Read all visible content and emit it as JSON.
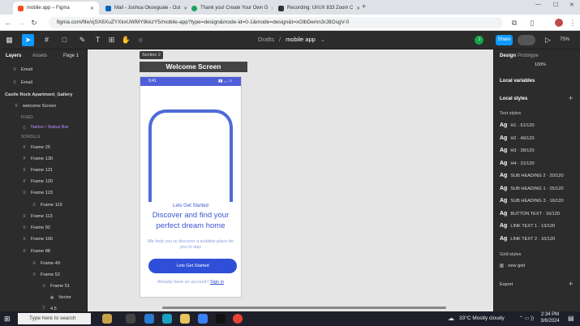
{
  "browser": {
    "tabs": [
      {
        "title": "mobile app – Figma",
        "active": true,
        "color": "#f24e1e"
      },
      {
        "title": "Mail - Joshua Okoeguale - Out",
        "active": false,
        "color": "#0a66c2"
      },
      {
        "title": "Thank you! Create Your Own G",
        "active": false,
        "color": "#1aa260"
      },
      {
        "title": "Recording: UI/UX 833 Zoom C",
        "active": false,
        "color": "#333333"
      }
    ],
    "url": "figma.com/file/xjSX6XuZYXkxUWMY9kkzY5/mobile-app?type=design&mode-id=0-1&mode=design&t=xOlbDemn3rJ8OsgV-0"
  },
  "figma": {
    "breadcrumb_drafts": "Drafts",
    "breadcrumb_sep": "/",
    "file_name": "mobile app",
    "share_label": "Share",
    "zoom": "75%",
    "avatar_initial": "J"
  },
  "layers_panel": {
    "tab_layers": "Layers",
    "tab_assets": "Assets",
    "page_label": "Page 1",
    "rows": [
      {
        "label": "Email",
        "indent": 28,
        "icon": "≡"
      },
      {
        "label": "Email",
        "indent": 28,
        "icon": "≡"
      },
      {
        "label": "Castle Rock Apartment_Gallery",
        "indent": 8,
        "icon": "",
        "bold": true
      },
      {
        "label": "welcome Screen",
        "indent": 18,
        "icon": "#"
      },
      {
        "label": "FIXED",
        "indent": 28,
        "icon": "",
        "section": true
      },
      {
        "label": "Native / Status Bar",
        "indent": 28,
        "icon": "◇",
        "purple": true
      },
      {
        "label": "SCROLLS",
        "indent": 28,
        "icon": "",
        "section": true
      },
      {
        "label": "Frame 25",
        "indent": 28,
        "icon": "#"
      },
      {
        "label": "Frame 130",
        "indent": 28,
        "icon": "#"
      },
      {
        "label": "Frame 121",
        "indent": 28,
        "icon": "#"
      },
      {
        "label": "Frame 120",
        "indent": 28,
        "icon": "#"
      },
      {
        "label": "Frame 123",
        "indent": 28,
        "icon": "≡"
      },
      {
        "label": "Frame 119",
        "indent": 40,
        "icon": "≡"
      },
      {
        "label": "Frame 113",
        "indent": 28,
        "icon": "≡"
      },
      {
        "label": "Frame 92",
        "indent": 28,
        "icon": "≡"
      },
      {
        "label": "Frame 100",
        "indent": 28,
        "icon": "≡"
      },
      {
        "label": "Frame 88",
        "indent": 28,
        "icon": "≡"
      },
      {
        "label": "Frame 49",
        "indent": 40,
        "icon": "≡"
      },
      {
        "label": "Frame 52",
        "indent": 40,
        "icon": "≡"
      },
      {
        "label": "Frame 51",
        "indent": 52,
        "icon": "≡"
      },
      {
        "label": "Vector",
        "indent": 62,
        "icon": "✱"
      },
      {
        "label": "4.5",
        "indent": 52,
        "icon": "T"
      }
    ]
  },
  "right_panel": {
    "tab_design": "Design",
    "tab_prototype": "Prototype",
    "top_value": "100%",
    "local_variables": "Local variables",
    "local_styles": "Local styles",
    "text_styles": "Text styles",
    "styles": [
      {
        "ag": "Ag",
        "name": "H1 · 61/120"
      },
      {
        "ag": "Ag",
        "name": "H2 · 49/120"
      },
      {
        "ag": "Ag",
        "name": "H3 · 39/120"
      },
      {
        "ag": "Ag",
        "name": "H4 · 31/120"
      },
      {
        "ag": "Ag",
        "name": "SUB HEADING 2 · 20/120"
      },
      {
        "ag": "Ag",
        "name": "SUB HEADING 1 · 25/120"
      },
      {
        "ag": "Ag",
        "name": "SUB HEADING 3 · 16/120"
      },
      {
        "ag": "Ag",
        "name": "BUTTON TEXT · 16/120"
      },
      {
        "ag": "Ag",
        "name": "LINK TEXT 1 · 13/120"
      },
      {
        "ag": "Ag",
        "name": "LINK TEXT 2 · 10/120"
      }
    ],
    "grid_styles": "Grid styles",
    "grid_name": "new grid",
    "export": "Export"
  },
  "canvas": {
    "section_label": "Section 2",
    "frame_title": "Welcome Screen",
    "phone": {
      "time": "9:41",
      "eyebrow": "Lets Get Started",
      "headline_1": "Discover and find your",
      "headline_2": "perfect  dream home",
      "subtext": "We help you to discover a suitable place for you to stay",
      "cta": "Lets Get Started",
      "signin_prefix": "Already have an account?",
      "signin_link": "Sign in"
    }
  },
  "taskbar": {
    "search_placeholder": "Type here to search",
    "weather": "33°C  Mostly cloudy",
    "time": "2:34 PM",
    "date": "3/6/2024"
  }
}
